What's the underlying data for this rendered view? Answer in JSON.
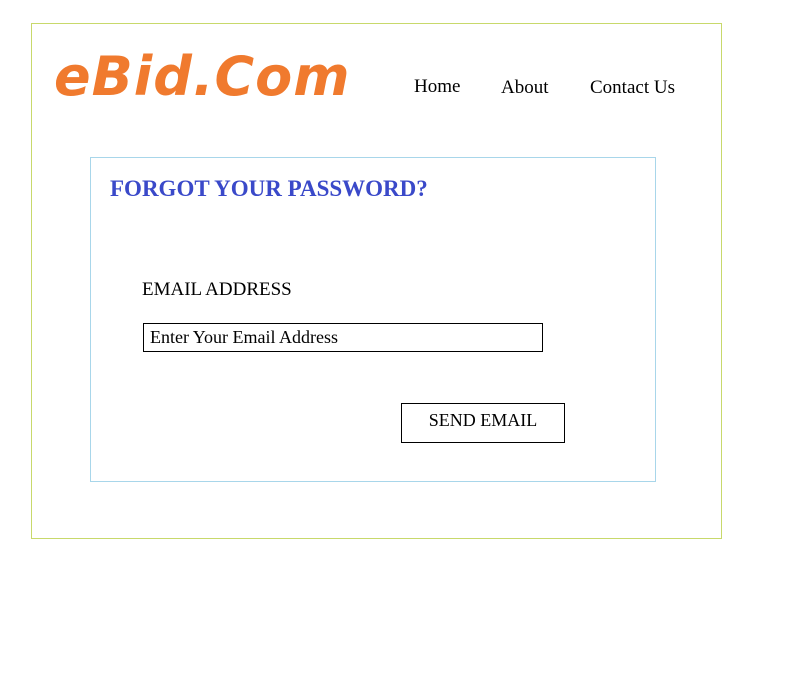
{
  "site": {
    "logo_text": "eBid.Com"
  },
  "nav": {
    "items": [
      {
        "label": "Home"
      },
      {
        "label": "About"
      },
      {
        "label": "Contact Us"
      }
    ]
  },
  "form": {
    "title": "FORGOT YOUR PASSWORD?",
    "email_label": "EMAIL ADDRESS",
    "email_placeholder": "Enter Your Email Address",
    "email_value": "",
    "submit_label": "SEND EMAIL"
  },
  "colors": {
    "logo": "#f07a2e",
    "title": "#3a49c9",
    "outer_border": "#c8d96b",
    "panel_border": "#a8d6ea"
  }
}
